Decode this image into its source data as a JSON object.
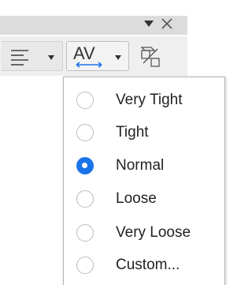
{
  "panel": {
    "menu_icon": "dropdown-arrow-icon",
    "close_icon": "close-icon"
  },
  "toolbar": {
    "buttons": [
      {
        "name": "align-button",
        "icon": "align-lines-icon"
      },
      {
        "name": "character-spacing-button",
        "icon": "character-spacing-icon",
        "text": "AV"
      },
      {
        "name": "transform-button",
        "icon": "transform-icon"
      }
    ]
  },
  "spacing_menu": {
    "options": [
      {
        "label": "Very Tight",
        "checked": false
      },
      {
        "label": "Tight",
        "checked": false
      },
      {
        "label": "Normal",
        "checked": true
      },
      {
        "label": "Loose",
        "checked": false
      },
      {
        "label": "Very Loose",
        "checked": false
      },
      {
        "label": "Custom...",
        "checked": false
      }
    ],
    "accent_color": "#1a73e8"
  }
}
